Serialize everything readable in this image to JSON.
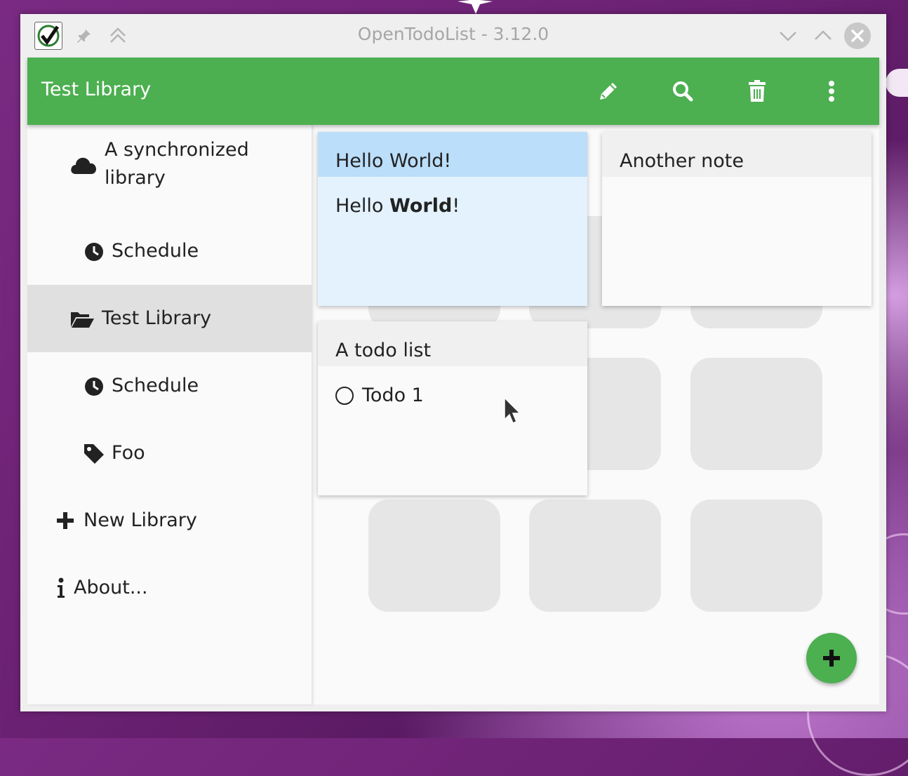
{
  "window": {
    "title": "OpenTodoList - 3.12.0"
  },
  "appbar": {
    "title": "Test Library",
    "accent": "#4caf50"
  },
  "sidebar": {
    "items": [
      {
        "label": "A synchronized library",
        "icon": "cloud-icon"
      },
      {
        "label": "Schedule",
        "icon": "clock-icon"
      },
      {
        "label": "Test Library",
        "icon": "folder-open-icon",
        "active": true
      },
      {
        "label": "Schedule",
        "icon": "clock-icon"
      },
      {
        "label": "Foo",
        "icon": "tag-icon"
      },
      {
        "label": "New Library",
        "icon": "plus-icon"
      },
      {
        "label": "About...",
        "icon": "info-icon"
      }
    ]
  },
  "cards": [
    {
      "title": "Hello World!",
      "body_plain": "Hello ",
      "body_bold": "World",
      "body_end": "!",
      "selected": true
    },
    {
      "title": "Another note"
    },
    {
      "title": "A todo list",
      "todos": [
        {
          "label": "Todo 1",
          "done": false
        }
      ]
    }
  ]
}
